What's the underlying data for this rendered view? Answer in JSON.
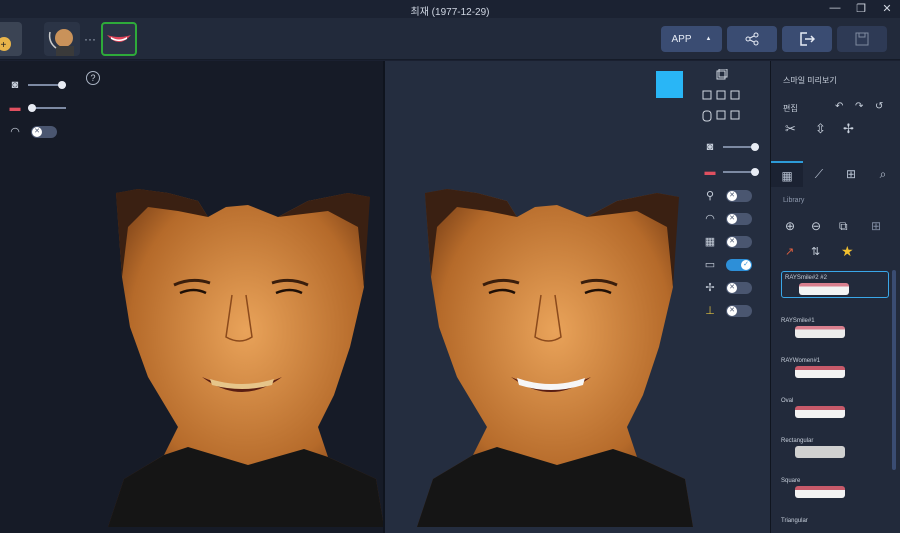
{
  "window": {
    "title": "최재 (1977-12-29)"
  },
  "toolbar": {
    "app_label": "APP",
    "app_caret": "▲"
  },
  "side_panel": {
    "heading": "스마일 미리보기",
    "edit_label": "편집",
    "library_label": "Library",
    "library_items": [
      "RAYSmile#2 #2",
      "RAYSmile#1",
      "RAYWomen#1",
      "Oval",
      "Rectangular",
      "Square",
      "Triangular"
    ]
  },
  "colors": {
    "accent": "#2d9bd8",
    "swatch": "#29b6f6",
    "active_thumb_border": "#2eaa3a"
  }
}
